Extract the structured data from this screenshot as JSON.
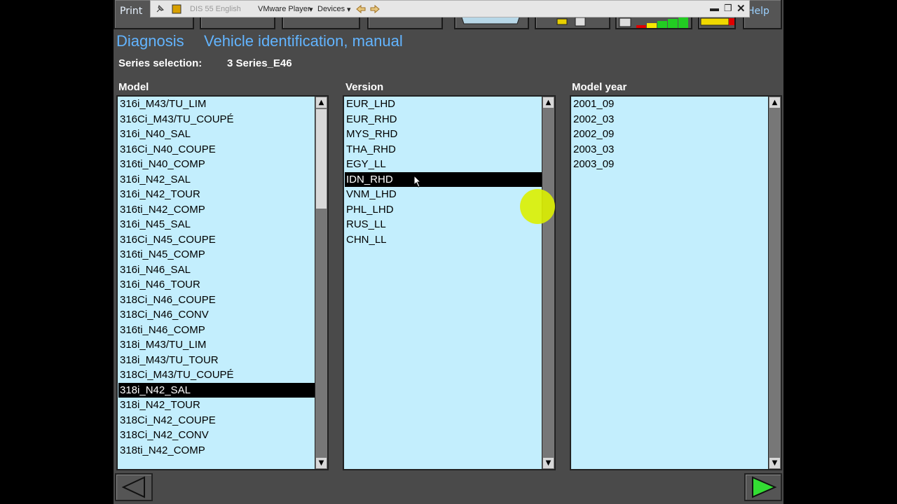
{
  "toolbar": {
    "print_label": "Print",
    "help_label": "Help"
  },
  "vmware": {
    "app_name": "DIS 55 English",
    "player_menu": "VMware Player",
    "devices_menu": "Devices"
  },
  "header": {
    "section": "Diagnosis",
    "page_title": "Vehicle identification, manual",
    "series_label": "Series selection:",
    "series_value": "3 Series_E46"
  },
  "model_list": {
    "header": "Model",
    "items": [
      "316i_M43/TU_LIM",
      "316Ci_M43/TU_COUPÉ",
      "316i_N40_SAL",
      "316Ci_N40_COUPE",
      "316ti_N40_COMP",
      "316i_N42_SAL",
      "316i_N42_TOUR",
      "316ti_N42_COMP",
      "316i_N45_SAL",
      "316Ci_N45_COUPE",
      "316ti_N45_COMP",
      "316i_N46_SAL",
      "316i_N46_TOUR",
      "318Ci_N46_COUPE",
      "318Ci_N46_CONV",
      "316ti_N46_COMP",
      "318i_M43/TU_LIM",
      "318i_M43/TU_TOUR",
      "318Ci_M43/TU_COUPÉ",
      "318i_N42_SAL",
      "318i_N42_TOUR",
      "318Ci_N42_COUPE",
      "318Ci_N42_CONV",
      "318ti_N42_COMP"
    ],
    "selected": "318i_N42_SAL"
  },
  "version_list": {
    "header": "Version",
    "items": [
      "EUR_LHD",
      "EUR_RHD",
      "MYS_RHD",
      "THA_RHD",
      "EGY_LL",
      "IDN_RHD",
      "VNM_LHD",
      "PHL_LHD",
      "RUS_LL",
      "CHN_LL"
    ],
    "selected": "IDN_RHD"
  },
  "year_list": {
    "header": "Model year",
    "items": [
      "2001_09",
      "2002_03",
      "2002_09",
      "2003_03",
      "2003_09"
    ]
  },
  "colors": {
    "list_bg": "#c3eefd",
    "title": "#62b4ff",
    "screen_bg": "#4a4a4a",
    "forward_arrow": "#33dd33",
    "cursor_highlight": "#dcf000"
  }
}
